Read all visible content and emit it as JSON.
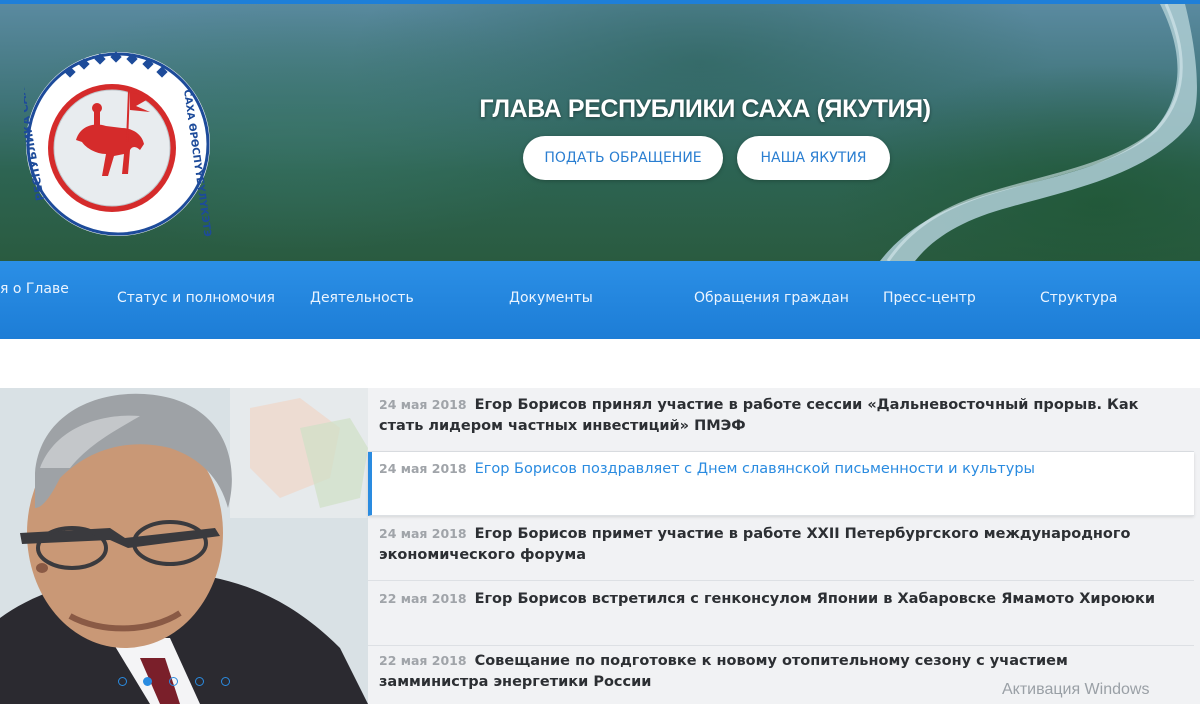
{
  "header": {
    "title": "ГЛАВА РЕСПУБЛИКИ САХА (ЯКУТИЯ)",
    "btn_appeal": "ПОДАТЬ ОБРАЩЕНИЕ",
    "btn_yakutia": "НАША ЯКУТИЯ",
    "logo_text_left": "РЕСПУБЛИКА САХА (ЯКУТИЯ)",
    "logo_text_right": "САХА ӨРӨСПҮҮБҮЛҮКЭТЭ"
  },
  "nav": {
    "items": [
      "я о Главе",
      "Статус и полномочия",
      "Деятельность",
      "Документы",
      "Обращения граждан",
      "Пресс-центр",
      "Структура"
    ]
  },
  "slider": {
    "dots_count": 5,
    "active_index": 1
  },
  "news": [
    {
      "date": "24 мая 2018",
      "text": "Егор Борисов принял участие в работе сессии «Дальневосточный прорыв. Как стать лидером частных инвестиций» ПМЭФ"
    },
    {
      "date": "24 мая 2018",
      "text": "Егор Борисов поздравляет с Днем славянской письменности и культуры"
    },
    {
      "date": "24 мая 2018",
      "text": "Егор Борисов примет участие в работе XXII Петербургского международного экономического форума"
    },
    {
      "date": "22 мая 2018",
      "text": "Егор Борисов встретился с генконсулом Японии в Хабаровске Ямамото Хироюки"
    },
    {
      "date": "22 мая 2018",
      "text": "Совещание по подготовке к новому отопительному сезону с участием замминистра энергетики России"
    }
  ],
  "watermark": "Активация Windows",
  "colors": {
    "accent": "#2a8be0",
    "nav_bg": "#1d7dd6",
    "logo_red": "#d52b2b",
    "logo_blue": "#1d4b9a"
  }
}
